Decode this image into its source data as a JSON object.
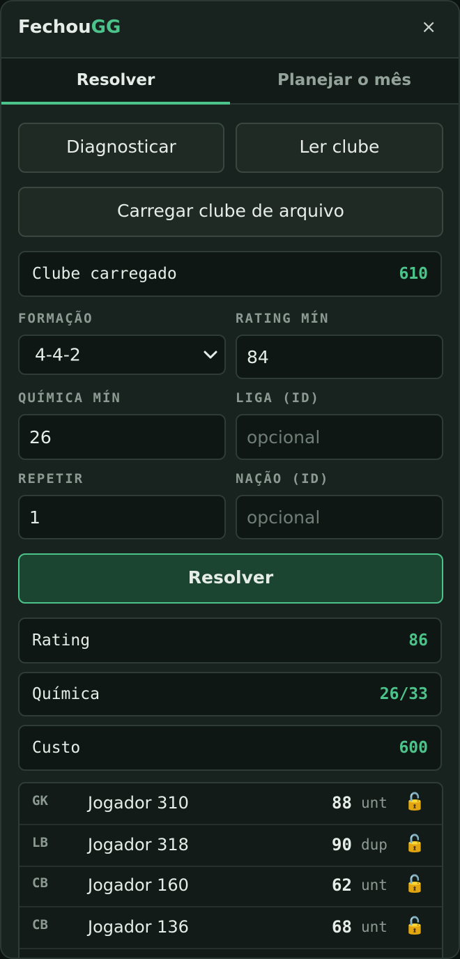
{
  "app": {
    "brand_main": "Fechou",
    "brand_accent": "GG",
    "close_symbol": "×"
  },
  "tabs": [
    {
      "label": "Resolver",
      "active": true
    },
    {
      "label": "Planejar o mês",
      "active": false
    }
  ],
  "actions": {
    "diagnose_label": "Diagnosticar",
    "read_club_label": "Ler clube",
    "load_file_label": "Carregar clube de arquivo"
  },
  "club": {
    "label": "Clube carregado",
    "count": "610"
  },
  "form": {
    "formation": {
      "label": "FORMAÇÃO",
      "value": "4-4-2"
    },
    "rating_min": {
      "label": "RATING MÍN",
      "value": "84"
    },
    "chem_min": {
      "label": "QUÍMICA MÍN",
      "value": "26"
    },
    "league": {
      "label": "LIGA (ID)",
      "placeholder": "opcional"
    },
    "repeat": {
      "label": "REPETIR",
      "value": "1"
    },
    "nation": {
      "label": "NAÇÃO (ID)",
      "placeholder": "opcional"
    }
  },
  "solve_label": "Resolver",
  "results": {
    "rating": {
      "label": "Rating",
      "value": "86"
    },
    "chemistry": {
      "label": "Química",
      "value": "26/33"
    },
    "cost": {
      "label": "Custo",
      "value": "600"
    }
  },
  "players": [
    {
      "pos": "GK",
      "name": "Jogador 310",
      "rating": "88",
      "tag": "unt",
      "lock": "🔓"
    },
    {
      "pos": "LB",
      "name": "Jogador 318",
      "rating": "90",
      "tag": "dup",
      "lock": "🔓"
    },
    {
      "pos": "CB",
      "name": "Jogador 160",
      "rating": "62",
      "tag": "unt",
      "lock": "🔓"
    },
    {
      "pos": "CB",
      "name": "Jogador 136",
      "rating": "68",
      "tag": "unt",
      "lock": "🔓"
    }
  ],
  "colors": {
    "accent": "#4cc38a",
    "background": "#18221e",
    "lock": "#e6b43c"
  }
}
